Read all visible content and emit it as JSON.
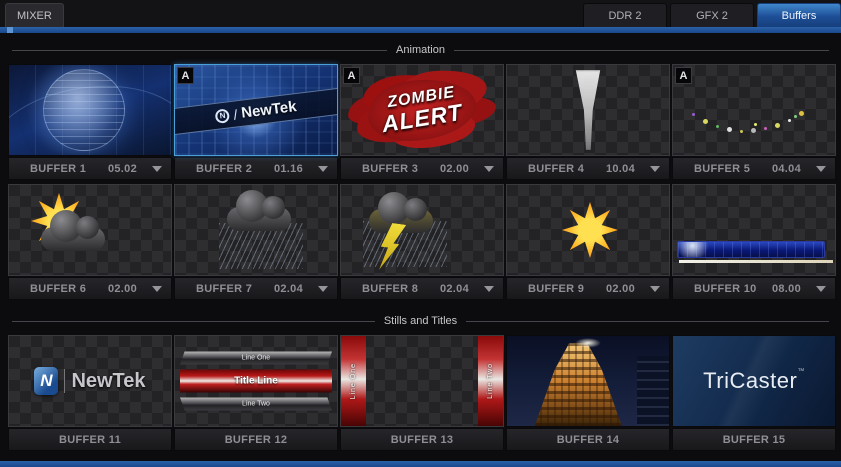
{
  "header": {
    "mixer_tab": "MIXER",
    "tabs": [
      {
        "label": "DDR 2"
      },
      {
        "label": "GFX 2"
      },
      {
        "label": "Buffers"
      }
    ],
    "active_tab": "Buffers"
  },
  "sections": {
    "animation": "Animation",
    "stills": "Stills and Titles"
  },
  "autoplay_badge": "A",
  "buffers": [
    {
      "label": "BUFFER 1",
      "time": "05.02"
    },
    {
      "label": "BUFFER 2",
      "time": "01.16"
    },
    {
      "label": "BUFFER 3",
      "time": "02.00"
    },
    {
      "label": "BUFFER 4",
      "time": "10.04"
    },
    {
      "label": "BUFFER 5",
      "time": "04.04"
    },
    {
      "label": "BUFFER 6",
      "time": "02.00"
    },
    {
      "label": "BUFFER 7",
      "time": "02.04"
    },
    {
      "label": "BUFFER 8",
      "time": "02.04"
    },
    {
      "label": "BUFFER 9",
      "time": "02.00"
    },
    {
      "label": "BUFFER 10",
      "time": "08.00"
    },
    {
      "label": "BUFFER 11"
    },
    {
      "label": "BUFFER 12"
    },
    {
      "label": "BUFFER 13"
    },
    {
      "label": "BUFFER 14"
    },
    {
      "label": "BUFFER 15"
    }
  ],
  "thumbs": {
    "newtek_mark": "N",
    "newtek_slash": "/",
    "newtek_text": "NewTek",
    "zombie_line1": "ZOMBIE",
    "zombie_line2": "ALERT",
    "title_line1": "Line One",
    "title_line2": "Title Line",
    "title_line3": "Line Two",
    "side_left_text": "Line One",
    "side_right_text": "Line Two",
    "tricaster_text": "TriCaster",
    "tricaster_tm": "™"
  },
  "colors": {
    "accent_blue": "#1d4e96",
    "tab_active_blue": "#4088cc",
    "label_text": "#8f8f94",
    "alert_red": "#b51c1c"
  }
}
